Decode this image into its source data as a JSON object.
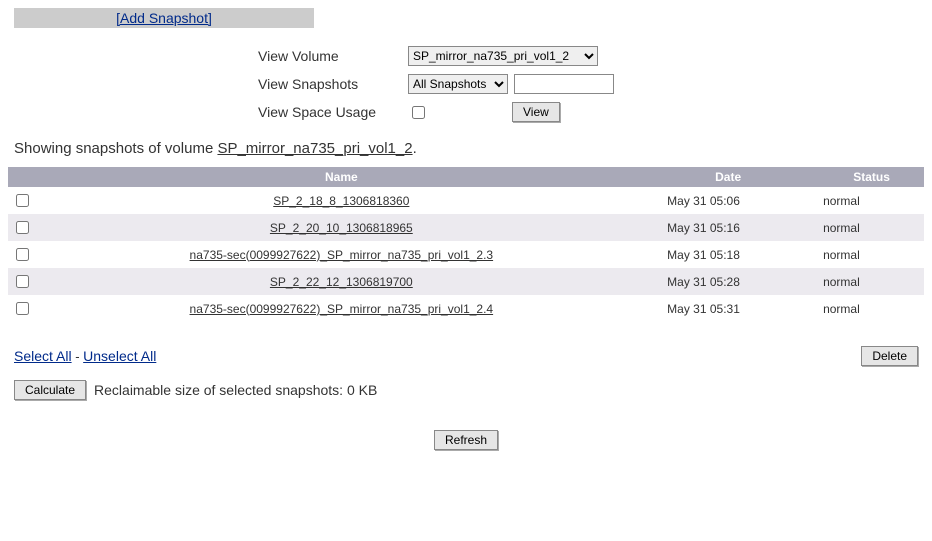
{
  "topbar": {
    "add_snapshot": "[Add Snapshot]"
  },
  "filters": {
    "view_volume_label": "View Volume",
    "view_volume_value": "SP_mirror_na735_pri_vol1_2",
    "view_snapshots_label": "View Snapshots",
    "view_snapshots_value": "All Snapshots",
    "view_snapshots_text": "",
    "view_space_usage_label": "View Space Usage",
    "view_button": "View"
  },
  "showing_prefix": "Showing snapshots of volume ",
  "showing_volume": "SP_mirror_na735_pri_vol1_2",
  "table": {
    "headers": {
      "name": "Name",
      "date": "Date",
      "status": "Status"
    },
    "rows": [
      {
        "name": "SP_2_18_8_1306818360",
        "date": "May 31 05:06",
        "status": "normal"
      },
      {
        "name": "SP_2_20_10_1306818965",
        "date": "May 31 05:16",
        "status": "normal"
      },
      {
        "name": "na735-sec(0099927622)_SP_mirror_na735_pri_vol1_2.3",
        "date": "May 31 05:18",
        "status": "normal"
      },
      {
        "name": "SP_2_22_12_1306819700",
        "date": "May 31 05:28",
        "status": "normal"
      },
      {
        "name": "na735-sec(0099927622)_SP_mirror_na735_pri_vol1_2.4",
        "date": "May 31 05:31",
        "status": "normal"
      }
    ]
  },
  "links": {
    "select_all": "Select All",
    "dash": " - ",
    "unselect_all": "Unselect All"
  },
  "buttons": {
    "delete": "Delete",
    "calculate": "Calculate",
    "refresh": "Refresh"
  },
  "reclaim_text": "Reclaimable size of selected snapshots: 0 KB"
}
